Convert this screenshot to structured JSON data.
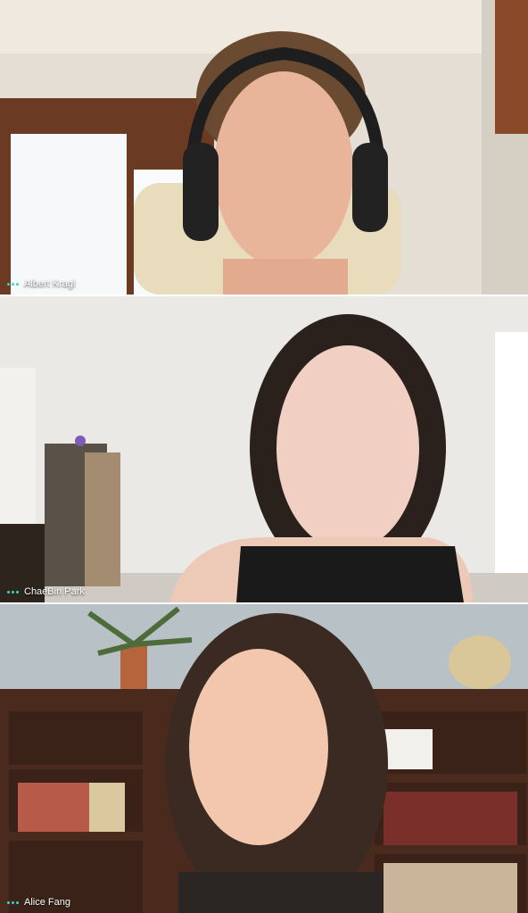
{
  "participants": [
    {
      "name": "Albert Kragl"
    },
    {
      "name": "ChaeBin Park"
    },
    {
      "name": "Alice Fang"
    }
  ],
  "accent_color": "#3ad6c0"
}
